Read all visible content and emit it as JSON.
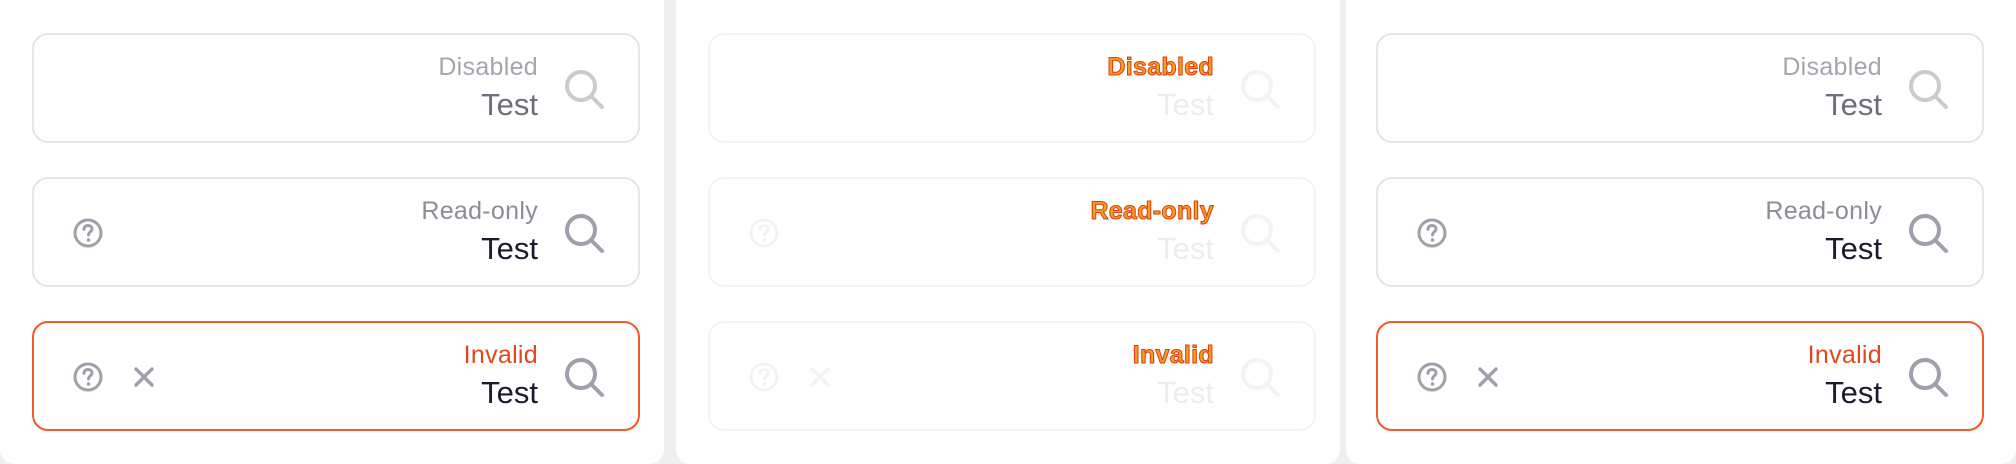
{
  "columns": [
    {
      "disabled": {
        "label": "Disabled",
        "value": "Test"
      },
      "readonly": {
        "label": "Read-only",
        "value": "Test"
      },
      "invalid": {
        "label": "Invalid",
        "value": "Test"
      }
    },
    {
      "disabled": {
        "label": "Disabled",
        "value": "Test"
      },
      "readonly": {
        "label": "Read-only",
        "value": "Test"
      },
      "invalid": {
        "label": "Invalid",
        "value": "Test"
      }
    },
    {
      "disabled": {
        "label": "Disabled",
        "value": "Test"
      },
      "readonly": {
        "label": "Read-only",
        "value": "Test"
      },
      "invalid": {
        "label": "Invalid",
        "value": "Test"
      }
    }
  ],
  "icons": {
    "help": "help-circle-icon",
    "clear": "close-icon",
    "search": "search-icon"
  },
  "colors": {
    "border": "#e6e6ea",
    "invalid_border": "#f05a28",
    "invalid_label": "#e2461c",
    "icon_gray": "#a0a0aa",
    "text_dark": "#1b1b2e"
  }
}
